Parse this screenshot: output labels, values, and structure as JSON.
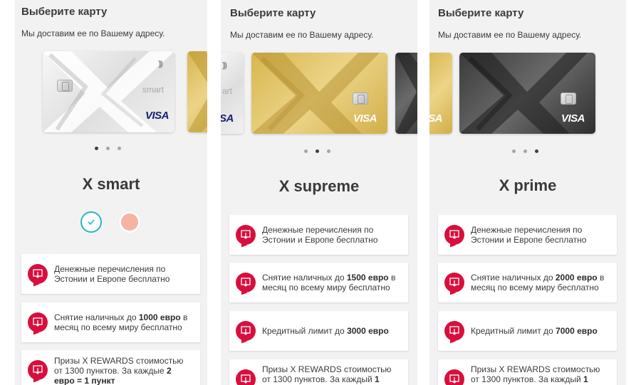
{
  "screens": [
    {
      "title": "Выберите карту",
      "subtitle": "Мы доставим ее по Вашему адресу.",
      "card_name": "X smart",
      "main_card": {
        "style": "silver",
        "word": "smart",
        "visa": "VISA",
        "contactless": ")))"
      },
      "peek_left": null,
      "peek_right": {
        "style": "gold"
      },
      "dots_active": 0,
      "features": [
        {
          "icon": "transfer-icon",
          "pre": "Денежные перечисления по Эстонии и Европе бесплатно",
          "bold": "",
          "post": ""
        },
        {
          "icon": "transfer-icon",
          "pre": "Снятие наличных до ",
          "bold": "1000 евро",
          "post": " в месяц по всему миру бесплатно"
        },
        {
          "icon": "transfer-icon",
          "pre": "Призы X REWARDS стоимостью от 1300 пунктов. За каждые ",
          "bold": "2 евро = 1 пункт",
          "post": ""
        }
      ]
    },
    {
      "title": "Выберите карту",
      "subtitle": "Мы доставим ее по Вашему адресу.",
      "card_name": "X supreme",
      "main_card": {
        "style": "gold",
        "visa": "VISA"
      },
      "peek_left": {
        "style": "silver",
        "word": "art",
        "visa": "SA",
        "contactless": ")))"
      },
      "peek_right": {
        "style": "black"
      },
      "dots_active": 1,
      "features": [
        {
          "icon": "transfer-icon",
          "pre": "Денежные перечисления по Эстонии и Европе бесплатно",
          "bold": "",
          "post": ""
        },
        {
          "icon": "transfer-icon",
          "pre": "Снятие наличных до ",
          "bold": "1500 евро",
          "post": " в месяц по всему миру бесплатно"
        },
        {
          "icon": "transfer-icon",
          "pre": "Кредитный лимит до ",
          "bold": "3000 евро",
          "post": ""
        },
        {
          "icon": "transfer-icon",
          "pre": "Призы X REWARDS стоимостью от 1300 пунктов. За каждый ",
          "bold": "1",
          "post": ""
        }
      ]
    },
    {
      "title": "Выберите карту",
      "subtitle": "Мы доставим ее по Вашему адресу.",
      "card_name": "X prime",
      "main_card": {
        "style": "black",
        "visa": "VISA"
      },
      "peek_left": {
        "style": "gold",
        "visa": "SA"
      },
      "peek_right": null,
      "dots_active": 2,
      "features": [
        {
          "icon": "transfer-icon",
          "pre": "Денежные перечисления по Эстонии и Европе бесплатно",
          "bold": "",
          "post": ""
        },
        {
          "icon": "transfer-icon",
          "pre": "Снятие наличных до ",
          "bold": "2000 евро",
          "post": " в месяц по всему миру бесплатно"
        },
        {
          "icon": "transfer-icon",
          "pre": "Кредитный лимит до ",
          "bold": "7000 евро",
          "post": ""
        },
        {
          "icon": "transfer-icon",
          "pre": "Призы X REWARDS стоимостью от 1300 пунктов. За каждый ",
          "bold": "1",
          "post": ""
        }
      ]
    }
  ],
  "colors": {
    "accent": "#d80f3d",
    "selected_ring": "#29b5c8",
    "unselected_fill": "#f6b3a4"
  }
}
